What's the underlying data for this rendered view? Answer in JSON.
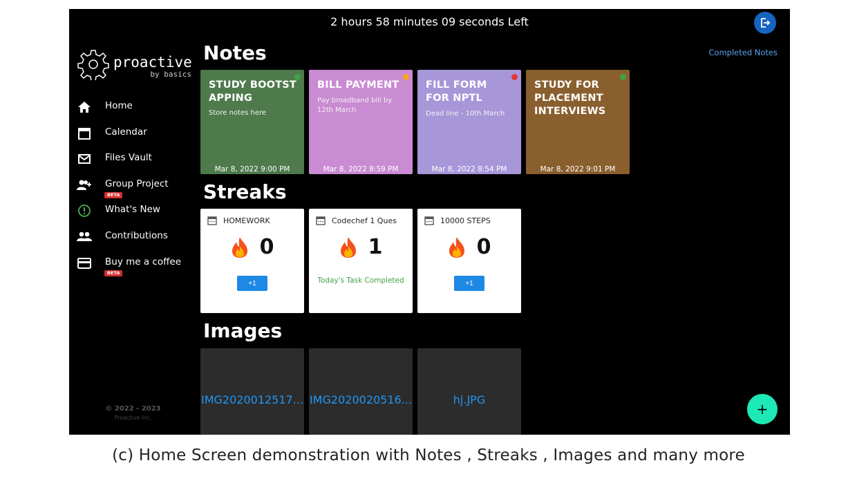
{
  "header": {
    "timer_text": "2 hours 58 minutes 09 seconds  Left"
  },
  "logo": {
    "word": "proactive",
    "sub": "by basics"
  },
  "nav": {
    "items": [
      {
        "label": "Home",
        "icon": "home-icon"
      },
      {
        "label": "Calendar",
        "icon": "calendar-icon"
      },
      {
        "label": "Files Vault",
        "icon": "mail-icon"
      },
      {
        "label": "Group Project",
        "icon": "add-group-icon",
        "badge": "BETA"
      },
      {
        "label": "What's New",
        "icon": "info-icon"
      },
      {
        "label": "Contributions",
        "icon": "people-icon"
      },
      {
        "label": "Buy me a coffee",
        "icon": "card-icon",
        "badge": "BETA"
      }
    ]
  },
  "footer": {
    "copyright": "© 2022 - 2023",
    "company": "Proactive Inc."
  },
  "notes_section": {
    "title": "Notes",
    "completed_link": "Completed Notes",
    "items": [
      {
        "title": "STUDY BOOTST APPING",
        "text": "Store notes here",
        "date": "Mar 8, 2022 9:00 PM",
        "color": "#4e7a4c",
        "dot": "#43a047"
      },
      {
        "title": "BILL PAYMENT",
        "text": "Pay broadband bill by 12th March",
        "date": "Mar 8, 2022 8:59 PM",
        "color": "#c98bd2",
        "dot": "#f5a623"
      },
      {
        "title": "FILL FORM FOR NPTL",
        "text": "Dead line - 10th March",
        "date": "Mar 8, 2022 8:54 PM",
        "color": "#a796d8",
        "dot": "#e53935"
      },
      {
        "title": "STUDY FOR PLACEMENT INTERVIEWS",
        "text": "",
        "date": "Mar 8, 2022 9:01 PM",
        "color": "#8a5f2e",
        "dot": "#43a047"
      }
    ]
  },
  "streaks_section": {
    "title": "Streaks",
    "items": [
      {
        "name": "HOMEWORK",
        "count": "0",
        "button": "+1"
      },
      {
        "name": "Codechef 1 Ques",
        "count": "1",
        "status": "Today's Task Completed"
      },
      {
        "name": "10000 STEPS",
        "count": "0",
        "button": "+1"
      }
    ]
  },
  "images_section": {
    "title": "Images",
    "items": [
      {
        "name": "IMG2020012517..."
      },
      {
        "name": "IMG2020020516..."
      },
      {
        "name": "hj.JPG"
      }
    ]
  },
  "fab": {
    "label": "+"
  },
  "caption": "(c) Home Screen demonstration with Notes , Streaks , Images  and many more"
}
